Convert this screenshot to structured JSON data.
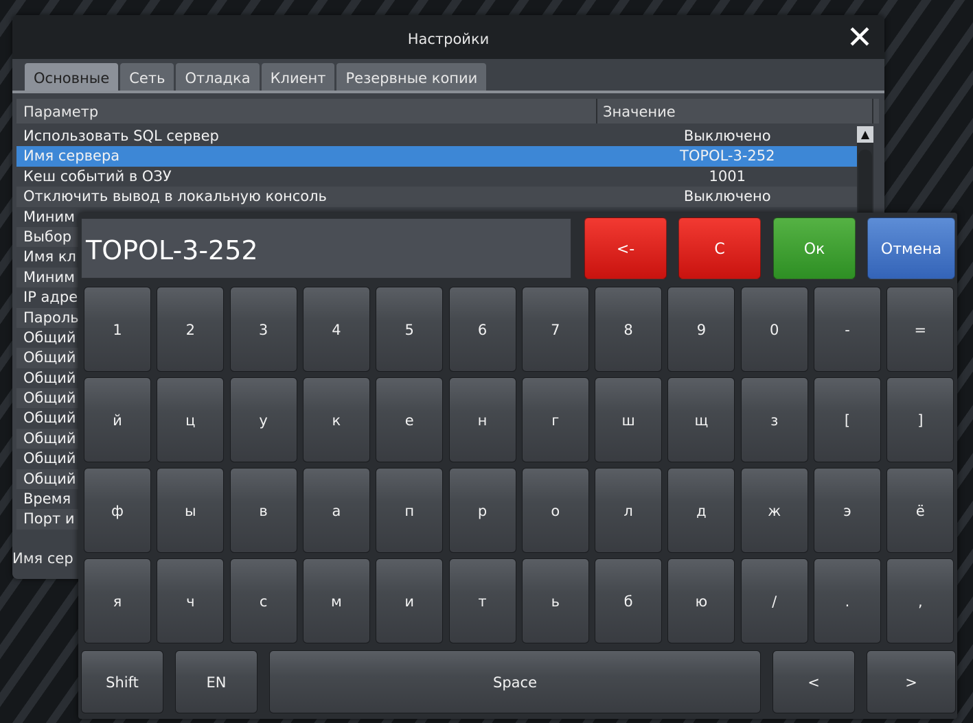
{
  "dialog": {
    "title": "Настройки",
    "close_icon": "close-icon"
  },
  "tabs": [
    {
      "label": "Основные"
    },
    {
      "label": "Сеть"
    },
    {
      "label": "Отладка"
    },
    {
      "label": "Клиент"
    },
    {
      "label": "Резервные копии"
    }
  ],
  "table": {
    "headers": {
      "param": "Параметр",
      "value": "Значение"
    },
    "rows": [
      {
        "name": "Использовать SQL сервер",
        "value": "Выключено"
      },
      {
        "name": "Имя сервера",
        "value": "TOPOL-3-252"
      },
      {
        "name": "Кеш событий в ОЗУ",
        "value": "1001"
      },
      {
        "name": "Отключить вывод в локальную консоль",
        "value": "Выключено"
      },
      {
        "name": "Миним",
        "value": ""
      },
      {
        "name": "Выбор",
        "value": ""
      },
      {
        "name": "Имя кл",
        "value": ""
      },
      {
        "name": "Миним",
        "value": ""
      },
      {
        "name": "IP адре",
        "value": ""
      },
      {
        "name": "Пароль",
        "value": ""
      },
      {
        "name": "Общий",
        "value": ""
      },
      {
        "name": "Общий",
        "value": ""
      },
      {
        "name": "Общий",
        "value": ""
      },
      {
        "name": "Общий",
        "value": ""
      },
      {
        "name": "Общий",
        "value": ""
      },
      {
        "name": "Общий",
        "value": ""
      },
      {
        "name": "Общий",
        "value": ""
      },
      {
        "name": "Общий",
        "value": ""
      },
      {
        "name": "Время",
        "value": ""
      },
      {
        "name": "Порт и",
        "value": ""
      }
    ]
  },
  "statusbar": {
    "text": "Имя сер"
  },
  "keyboard": {
    "display": "TOPOL-3-252",
    "backspace": "<-",
    "clear": "C",
    "ok": "Ок",
    "cancel": "Отмена",
    "rows": [
      [
        "1",
        "2",
        "3",
        "4",
        "5",
        "6",
        "7",
        "8",
        "9",
        "0",
        "-",
        "="
      ],
      [
        "й",
        "ц",
        "у",
        "к",
        "е",
        "н",
        "г",
        "ш",
        "щ",
        "з",
        "[",
        "]"
      ],
      [
        "ф",
        "ы",
        "в",
        "а",
        "п",
        "р",
        "о",
        "л",
        "д",
        "ж",
        "э",
        "ё"
      ],
      [
        "я",
        "ч",
        "с",
        "м",
        "и",
        "т",
        "ь",
        "б",
        "ю",
        "/",
        ".",
        ","
      ]
    ],
    "shift": "Shift",
    "lang": "EN",
    "space": "Space",
    "left": "<",
    "right": ">"
  },
  "colors": {
    "selected_row": "#3d87d6",
    "key_red": "#e0201a",
    "key_green": "#3fa232",
    "key_blue": "#4a7bcb"
  }
}
